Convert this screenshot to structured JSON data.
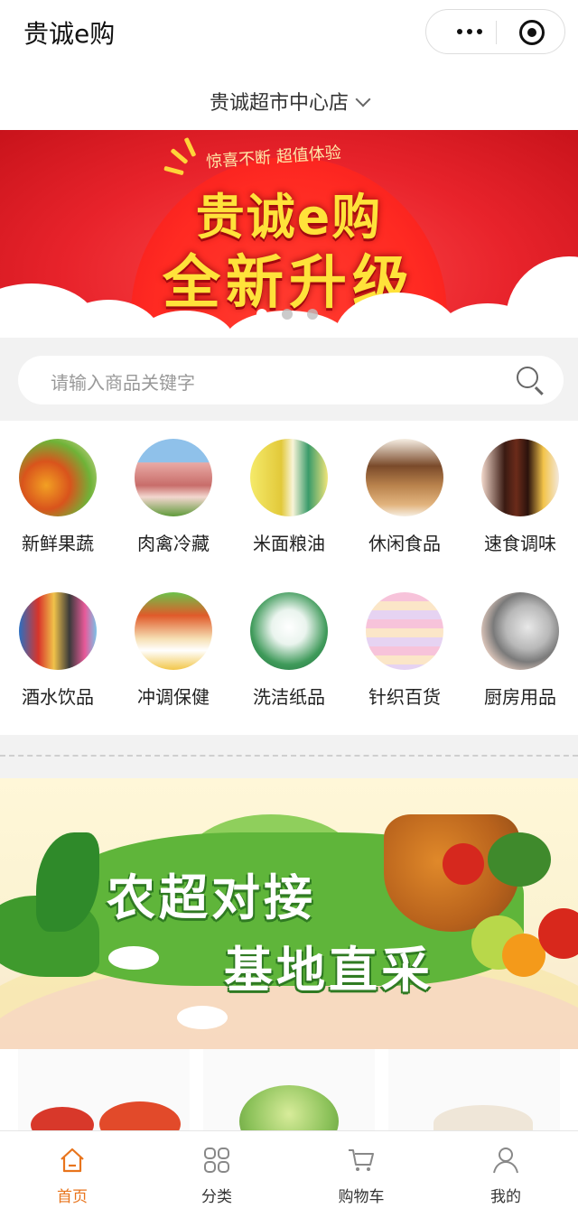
{
  "header": {
    "app_title": "贵诚e购",
    "more_icon": "more-dots-icon",
    "close_icon": "target-close-icon"
  },
  "store": {
    "name": "贵诚超市中心店",
    "chevron_icon": "chevron-down-icon"
  },
  "banner": {
    "tagline": "惊喜不断 超值体验",
    "brand": "贵诚e购",
    "headline": "全新升级",
    "slide_count": 3,
    "active_slide": 1
  },
  "search": {
    "placeholder": "请输入商品关键字",
    "icon": "search-icon"
  },
  "categories": [
    {
      "label": "新鲜果蔬",
      "icon": "fruit-veg-icon"
    },
    {
      "label": "肉禽冷藏",
      "icon": "meat-icon"
    },
    {
      "label": "米面粮油",
      "icon": "grain-oil-icon"
    },
    {
      "label": "休闲食品",
      "icon": "snack-icon"
    },
    {
      "label": "速食调味",
      "icon": "seasoning-icon"
    },
    {
      "label": "酒水饮品",
      "icon": "drinks-icon"
    },
    {
      "label": "冲调保健",
      "icon": "health-drink-icon"
    },
    {
      "label": "洗洁纸品",
      "icon": "cleaning-icon"
    },
    {
      "label": "针织百货",
      "icon": "textile-icon"
    },
    {
      "label": "厨房用品",
      "icon": "kitchen-icon"
    }
  ],
  "promo": {
    "line1": "农超对接",
    "line2": "基地直采"
  },
  "tabbar": [
    {
      "label": "首页",
      "icon": "home-icon",
      "active": true
    },
    {
      "label": "分类",
      "icon": "category-grid-icon",
      "active": false
    },
    {
      "label": "购物车",
      "icon": "cart-icon",
      "active": false
    },
    {
      "label": "我的",
      "icon": "user-icon",
      "active": false
    }
  ],
  "colors": {
    "accent": "#e8741c",
    "banner_red": "#e8232b",
    "banner_gold": "#ffe23a",
    "promo_green": "#3f9a2d"
  }
}
